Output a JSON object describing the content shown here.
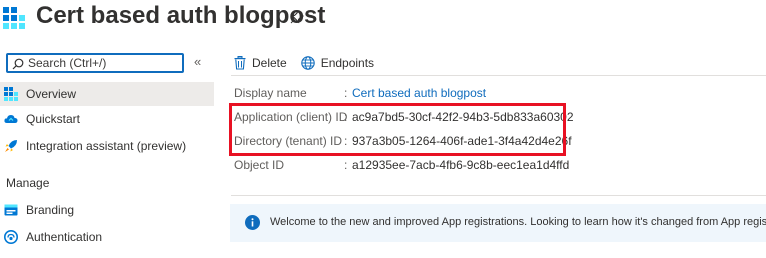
{
  "header": {
    "title": "Cert based auth blogpost"
  },
  "sidebar": {
    "search": {
      "placeholder": "Search (Ctrl+/)",
      "collapse_glyph": "«"
    },
    "items": [
      {
        "label": "Overview",
        "icon": "overview-grid-icon",
        "active": true
      },
      {
        "label": "Quickstart",
        "icon": "quickstart-cloud-icon"
      },
      {
        "label": "Integration assistant (preview)",
        "icon": "rocket-icon"
      }
    ],
    "section_label": "Manage",
    "manage_items": [
      {
        "label": "Branding",
        "icon": "branding-icon"
      },
      {
        "label": "Authentication",
        "icon": "authentication-icon"
      }
    ]
  },
  "toolbar": {
    "delete_label": "Delete",
    "endpoints_label": "Endpoints"
  },
  "essentials": [
    {
      "key": "Display name",
      "value": "Cert based auth blogpost",
      "link": true
    },
    {
      "key": "Application (client) ID",
      "value": "ac9a7bd5-30cf-42f2-94b3-5db833a60302"
    },
    {
      "key": "Directory (tenant) ID",
      "value": "937a3b05-1264-406f-ade1-3f4a42d4e26f"
    },
    {
      "key": "Object ID",
      "value": "a12935ee-7acb-4fb6-9c8b-eec1ea1d4ffd"
    }
  ],
  "separator": ":",
  "banner": {
    "message": "Welcome to the new and improved App registrations. Looking to learn how it's changed from App registrations"
  },
  "colors": {
    "accent": "#0f6cbd",
    "highlight": "#e81123",
    "active_bg": "#edebe9",
    "banner_bg": "#eff6fc"
  }
}
